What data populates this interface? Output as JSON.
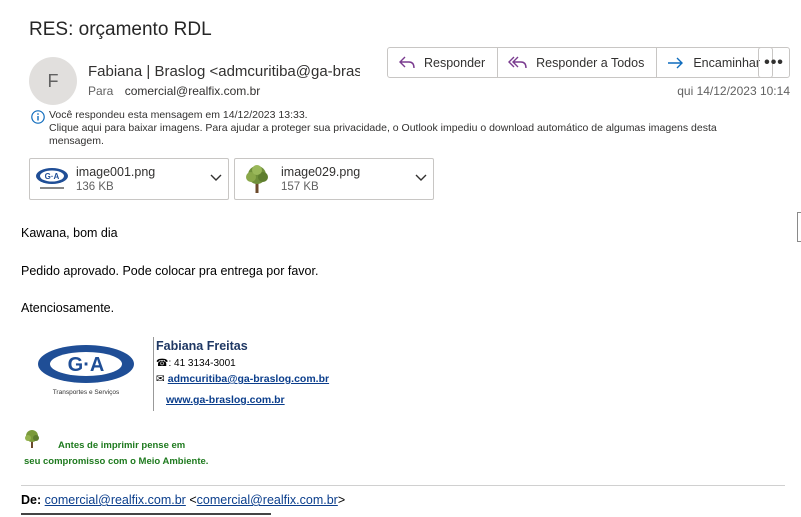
{
  "email": {
    "subject": "RES: orçamento RDL",
    "avatar_initial": "F",
    "sender": "Fabiana | Braslog <admcuritiba@ga-braslog.com.br>",
    "to_label": "Para",
    "to_value": "comercial@realfix.com.br",
    "date": "qui 14/12/2023 10:14"
  },
  "actions": {
    "reply": "Responder",
    "reply_all": "Responder a Todos",
    "forward": "Encaminhar",
    "more": "•••"
  },
  "info": {
    "line1": "Você respondeu esta mensagem em 14/12/2023 13:33.",
    "line2": "Clique aqui para baixar imagens. Para ajudar a proteger sua privacidade, o Outlook impediu o download automático de algumas imagens desta",
    "line3": "mensagem."
  },
  "attachments": [
    {
      "name": "image001.png",
      "size": "136 KB"
    },
    {
      "name": "image029.png",
      "size": "157 KB"
    }
  ],
  "body": {
    "greeting": "Kawana, bom dia",
    "message": "Pedido aprovado. Pode colocar pra entrega por favor.",
    "closing": "Atenciosamente."
  },
  "signature": {
    "logo_text": "G·A",
    "logo_tagline": "Transportes e Serviços",
    "name": "Fabiana Freitas",
    "phone": "☎: 41 3134-3001",
    "email_icon": "✉",
    "email": "admcuritiba@ga-braslog.com.br",
    "website": "www.ga-braslog.com.br",
    "eco_line1": "Antes de imprimir pense em",
    "eco_line2": "seu compromisso com o Meio Ambiente."
  },
  "quoted": {
    "from_label": "De:",
    "from_addr": "comercial@realfix.com.br",
    "from_addr2": "comercial@realfix.com.br"
  },
  "colors": {
    "accent": "#0f6cbd",
    "signature_name": "#1f3864",
    "eco_green": "#1e7a1e",
    "link": "#0b3e8c"
  }
}
